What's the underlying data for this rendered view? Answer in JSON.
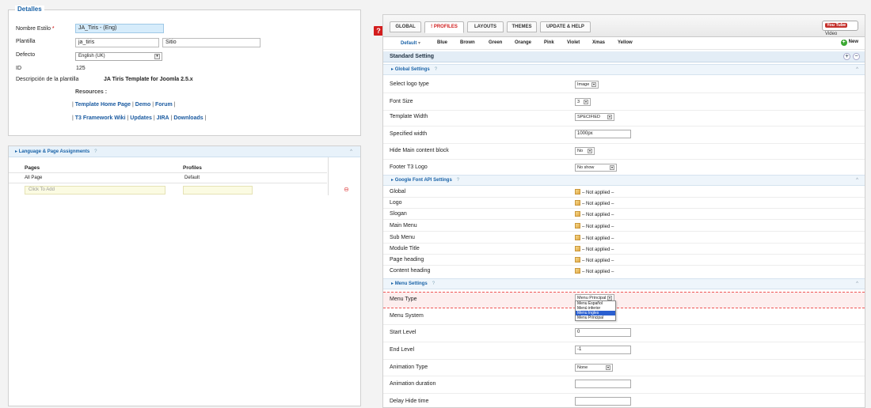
{
  "details": {
    "legend": "Detalles",
    "nombre_label": "Nombre Estilo",
    "nombre_required": "*",
    "nombre_value": "JA_Tiris - (Eng)",
    "plantilla_label": "Plantilla",
    "plantilla_value": "ja_tiris",
    "plantilla_site_value": "Sitio",
    "defecto_label": "Defecto",
    "defecto_value": "English (UK)",
    "id_label": "ID",
    "id_value": "125",
    "desc_label": "Descripción de la plantilla",
    "desc_value": "JA Tiris Template for Joomla 2.5.x",
    "resources_label": "Resources :",
    "links_line1": [
      "Template Home Page",
      "Demo",
      "Forum"
    ],
    "links_line2": [
      "T3 Framework Wiki",
      "Updates",
      "JIRA",
      "Downloads"
    ],
    "separator": "|"
  },
  "language": {
    "title": "Language & Page Assignments",
    "help": "?",
    "caret": "^",
    "col_pages": "Pages",
    "col_profiles": "Profiles",
    "row_page": "All Page",
    "row_profile": "Default",
    "add_placeholder": "Click To Add"
  },
  "help_icon": "?",
  "tabs": [
    "GLOBAL",
    "PROFILES",
    "LAYOUTS",
    "THEMES",
    "UPDATE & HELP"
  ],
  "tab_profiles_prefix": "!",
  "video": {
    "yt": "You Tube",
    "label": "Video"
  },
  "profiles": {
    "items": [
      "Default",
      "Blue",
      "Brown",
      "Green",
      "Orange",
      "Pink",
      "Violet",
      "Xmas",
      "Yellow"
    ],
    "default_arrow": "▾",
    "new_label": "New",
    "new_icon": "+"
  },
  "standard": {
    "title": "Standard Setting",
    "plus": "+",
    "minus": "−"
  },
  "global_settings": {
    "title": "Global Settings",
    "help": "?",
    "caret": "^",
    "rows": [
      {
        "label": "Select logo type",
        "value": "Image"
      },
      {
        "label": "Font Size",
        "value": "3"
      },
      {
        "label": "Template Width",
        "value": "SPECIFIED"
      },
      {
        "label": "Specified width",
        "value": "1000px"
      },
      {
        "label": "Hide Main content block",
        "value": "No"
      },
      {
        "label": "Footer T3 Logo",
        "value": "No show"
      }
    ]
  },
  "google_font": {
    "title": "Google Font API Settings",
    "help": "?",
    "caret": "^",
    "not_applied": "– Not applied –",
    "rows": [
      "Global",
      "Logo",
      "Slogan",
      "Main Menu",
      "Sub Menu",
      "Module Title",
      "Page heading",
      "Content heading"
    ]
  },
  "menu_settings": {
    "title": "Menu Settings",
    "help": "?",
    "caret": "^",
    "menu_type_label": "Menu Type",
    "menu_type_value": "Menu Principal",
    "dropdown_options": [
      "Menu Español",
      "Menú inferior",
      "Menu Ingles",
      "Menu Principal"
    ],
    "dropdown_selected": 2,
    "menu_system_label": "Menu System",
    "start_level_label": "Start Level",
    "start_level_value": "0",
    "end_level_label": "End Level",
    "end_level_value": "-1",
    "animation_type_label": "Animation Type",
    "animation_type_value": "None",
    "animation_duration_label": "Animation duration",
    "delay_hide_label": "Delay Hide time"
  }
}
